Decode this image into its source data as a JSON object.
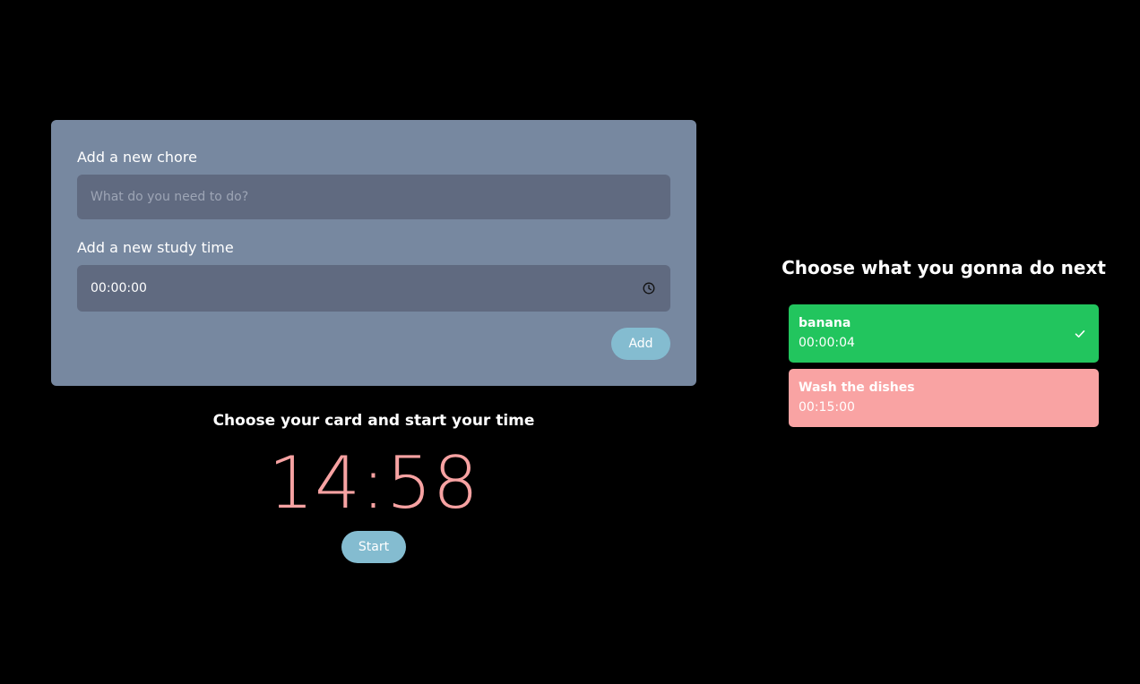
{
  "form": {
    "chore_label": "Add a new chore",
    "chore_placeholder": "What do you need to do?",
    "chore_value": "",
    "time_label": "Add a new study time",
    "time_value": "00:00:00",
    "add_label": "Add"
  },
  "timer": {
    "heading": "Choose your card and start your time",
    "display": "14:58",
    "start_label": "Start"
  },
  "tasks": {
    "heading": "Choose what you gonna do next",
    "items": [
      {
        "title": "banana",
        "time": "00:00:04",
        "status": "done",
        "color": "#22c55e"
      },
      {
        "title": "Wash the dishes",
        "time": "00:15:00",
        "status": "pending",
        "color": "#f9a3a3"
      }
    ]
  },
  "colors": {
    "background": "#000000",
    "panel": "#7788a0",
    "input": "#606a80",
    "button": "#84bcd0",
    "timer_text": "#f7a2a2"
  },
  "icons": {
    "time_input": "clock-icon",
    "task_done": "check-icon"
  }
}
